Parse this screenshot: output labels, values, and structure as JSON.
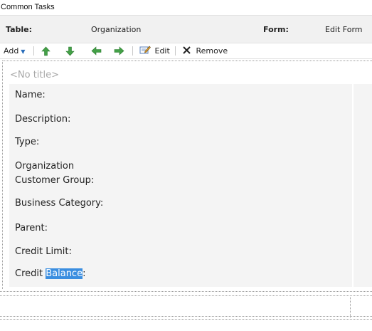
{
  "header": {
    "title": "Common Tasks"
  },
  "table_form": {
    "table_label": "Table:",
    "table_value": "Organization",
    "form_label": "Form:",
    "form_value": "Edit Form"
  },
  "toolbar": {
    "add_label": "Add",
    "edit_label": "Edit",
    "remove_label": "Remove",
    "icons": [
      "up-arrow-icon",
      "down-arrow-icon",
      "left-arrow-icon",
      "right-arrow-icon",
      "edit-icon",
      "remove-icon"
    ]
  },
  "panel": {
    "no_title": "<No title>",
    "fields": [
      {
        "label": "Name:"
      },
      {
        "label": "Description:"
      },
      {
        "label": "Type:"
      },
      {
        "label_line1": "Organization",
        "label_line2": "Customer Group:"
      },
      {
        "label": "Business Category:"
      },
      {
        "label": "Parent:"
      },
      {
        "label": "Credit Limit:"
      },
      {
        "label_prefix": "Credit ",
        "label_highlight": "Balance",
        "label_suffix": ":"
      }
    ]
  },
  "colors": {
    "toolbar_arrow_up_down": "#4caf50",
    "toolbar_arrow_left_right": "#4caf50",
    "selection_highlight": "#3b8ee0",
    "add_caret": "#2a6ebb"
  }
}
